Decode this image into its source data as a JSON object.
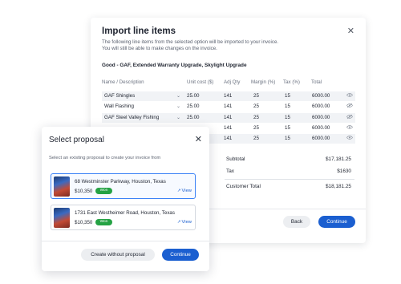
{
  "import_modal": {
    "title": "Import line items",
    "description": "The following line items from the selected option will be imported to your invoice. You will still be able to make changes on the invoice.",
    "option_label": "Good - GAF, Extended Warranty Upgrade, Skylight Upgrade",
    "columns": [
      "Name / Description",
      "Unit cost ($)",
      "Adj Qty",
      "Margin (%)",
      "Tax (%)",
      "Total"
    ],
    "rows": [
      {
        "name": "GAF Shingles",
        "unit_cost": "25.00",
        "qty": "141",
        "margin": "25",
        "tax": "15",
        "total": "6000.00",
        "visible": true
      },
      {
        "name": "Wall Flashing",
        "unit_cost": "25.00",
        "qty": "141",
        "margin": "25",
        "tax": "15",
        "total": "6000.00",
        "visible": false
      },
      {
        "name": "GAF Steel Valley Fishing",
        "unit_cost": "25.00",
        "qty": "141",
        "margin": "25",
        "tax": "15",
        "total": "6000.00",
        "visible": false
      },
      {
        "name": "",
        "unit_cost": "",
        "qty": "141",
        "margin": "25",
        "tax": "15",
        "total": "6000.00",
        "visible": true
      },
      {
        "name": "",
        "unit_cost": "",
        "qty": "141",
        "margin": "25",
        "tax": "15",
        "total": "6000.00",
        "visible": true
      }
    ],
    "summary": {
      "subtotal_label": "Subtotal",
      "subtotal_value": "$17,181.25",
      "tax_label": "Tax",
      "tax_value": "$1630",
      "total_label": "Customer Total",
      "total_value": "$18,181.25"
    },
    "back_label": "Back",
    "continue_label": "Continue"
  },
  "proposal_modal": {
    "title": "Select proposal",
    "subtitle": "Select an existing proposal to create your invoice from",
    "proposals": [
      {
        "address": "68 Westminster Parkway, Houston, Texas",
        "price": "$10,350",
        "status": "Won",
        "view_label": "View",
        "selected": true
      },
      {
        "address": "1731 East Westheimer Road, Houston, Texas",
        "price": "$10,350",
        "status": "Won",
        "view_label": "View",
        "selected": false
      }
    ],
    "create_without_label": "Create without proposal",
    "continue_label": "Continue"
  },
  "icons": {
    "close": "close-icon",
    "chevron": "chevron-down-icon",
    "eye": "eye-icon",
    "eye_off": "eye-off-icon",
    "external": "external-link-icon"
  },
  "colors": {
    "primary": "#1b5fd0",
    "won_badge": "#25a244",
    "selected_border": "#3b82f6"
  }
}
